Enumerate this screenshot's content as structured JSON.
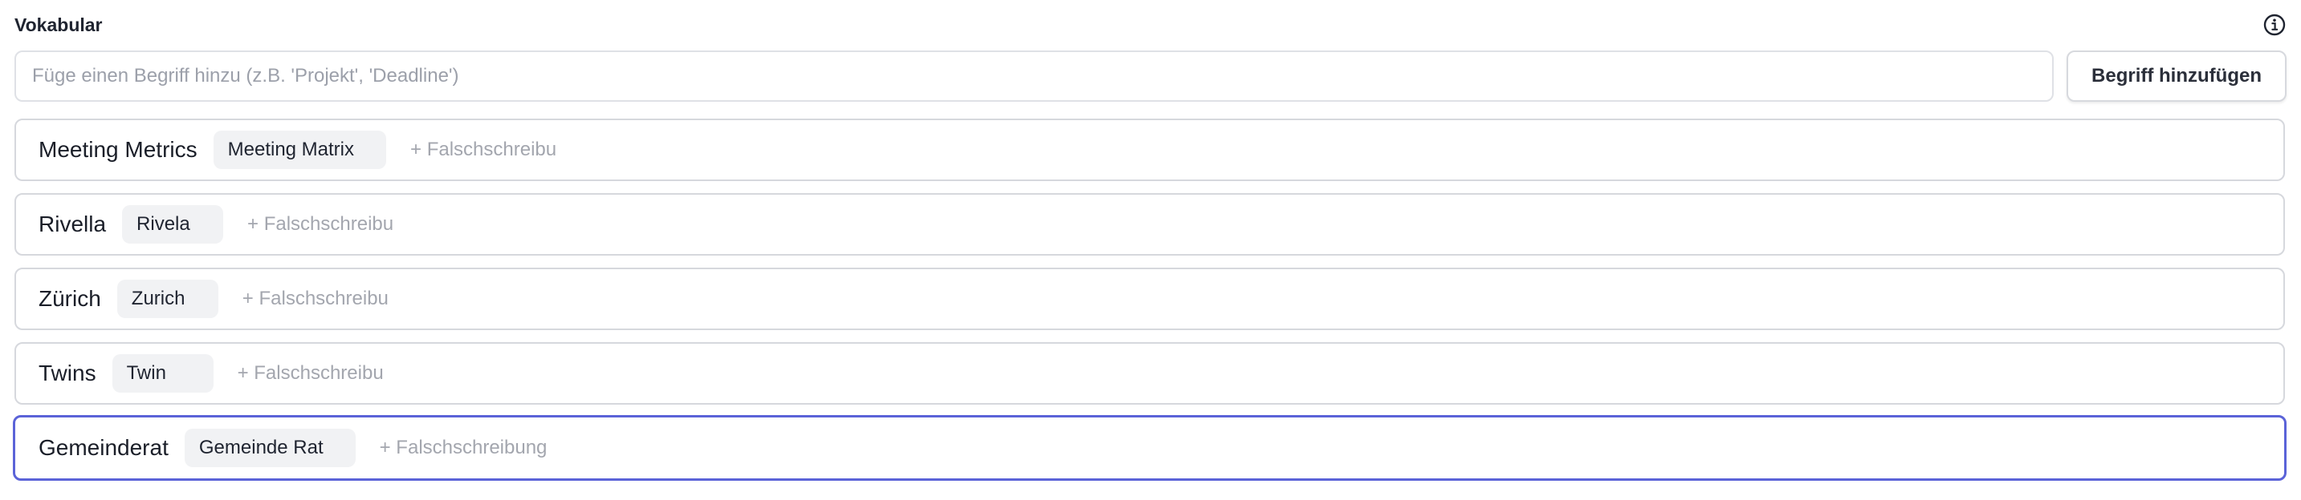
{
  "section": {
    "title": "Vokabular",
    "info_icon": "info-icon"
  },
  "add_term": {
    "placeholder": "Füge einen Begriff hinzu (z.B. 'Projekt', 'Deadline')",
    "value": "",
    "button_label": "Begriff hinzufügen"
  },
  "colors": {
    "border": "#d6d8dd",
    "active_border": "#5b63d8",
    "chip_bg": "#f1f2f4",
    "placeholder": "#9ca0aa"
  },
  "vocabulary": [
    {
      "term": "Meeting Metrics",
      "misspellings": [
        "Meeting Matrix"
      ],
      "add_placeholder": "+ Falschschreibu"
    },
    {
      "term": "Rivella",
      "misspellings": [
        "Rivela"
      ],
      "add_placeholder": "+ Falschschreibu"
    },
    {
      "term": "Zürich",
      "misspellings": [
        "Zurich"
      ],
      "add_placeholder": "+ Falschschreibu"
    },
    {
      "term": "Twins",
      "misspellings": [
        "Twin"
      ],
      "add_placeholder": "+ Falschschreibu"
    },
    {
      "term": "Gemeinderat",
      "misspellings": [
        "Gemeinde Rat"
      ],
      "add_placeholder": "+ Falschschreibung",
      "active": true
    }
  ]
}
